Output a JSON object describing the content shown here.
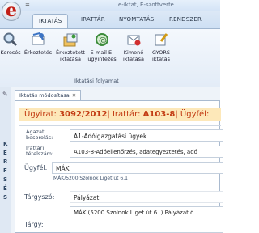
{
  "window": {
    "title": "e-iktat, E-szoftverfe",
    "quick_access": "="
  },
  "tabs": [
    {
      "label": "IKTATÁS",
      "active": true
    },
    {
      "label": "IRATTÁR"
    },
    {
      "label": "NYOMTATÁS"
    },
    {
      "label": "RENDSZER"
    }
  ],
  "ribbon": {
    "buttons": [
      {
        "label": "Keresés",
        "icon": "search-icon"
      },
      {
        "label": "Érkeztetés",
        "icon": "receive-icon"
      },
      {
        "label": "Érkeztetett iktatása",
        "icon": "file-incoming-icon"
      },
      {
        "label": "E-mail E-ügyintézés",
        "icon": "email-icon"
      },
      {
        "label": "Kimenő iktatása",
        "icon": "outgoing-icon"
      },
      {
        "label": "GYORS iktatás",
        "icon": "quick-icon"
      }
    ],
    "group_label": "Iktatási folyamat"
  },
  "side_label": "KERESÉS",
  "doc": {
    "tab_label": "Iktatás módosítása",
    "header": {
      "prefix": "Ügyirat:",
      "number": "3092/2012",
      "sep1": "| Irattár:",
      "irattar": "A103-8",
      "sep2": "| Ügyfél:"
    },
    "fields": {
      "agazati_label": "Ágazati besorolás:",
      "agazati_value": "A1-Adóigazgatási ügyek",
      "irattari_label": "Irattári tételszám:",
      "irattari_value": "A103-8-Adóellenőrzés, adategyeztetés, adó",
      "ugyfel_label": "Ügyfél:",
      "ugyfel_value": "MÁK",
      "ugyfel_sub": "MÁK/5200 Szolnok Liget út 6.1",
      "targyszo_label": "Tárgyszó:",
      "targyszo_value": "Pályázat",
      "targy_label": "Tárgy:",
      "targy_value": "MÁK (5200 Szolnok Liget út 6. ) Pályázat ö"
    }
  }
}
